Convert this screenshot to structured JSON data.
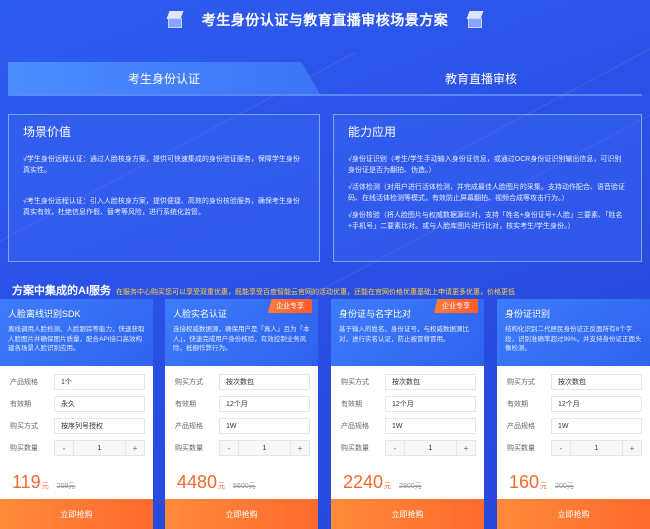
{
  "header": {
    "title": "考生身份认证与教育直播审核场景方案"
  },
  "tabs": [
    {
      "label": "考生身份认证",
      "active": true
    },
    {
      "label": "教育直播审核",
      "active": false
    }
  ],
  "left_panel": {
    "title": "场景价值",
    "paragraphs": [
      "√学生身份远程认证：通过人脸核身方案，提供可快速集成的身份验证服务，保障学生身份真实性。",
      "√考生身份远程认证：引入人脸核身方案，提供便捷、高效的身份核验服务，确保考生身份真实有效，杜绝信息作假、替考等风险，进行系统化监管。"
    ]
  },
  "right_panel": {
    "title": "能力应用",
    "paragraphs": [
      "√身份证识别（考生/学生手动输入身份证信息，或通过OCR身份证识别输出信息，可识别身份证是否为翻拍、伪造。）",
      "√活体检测（对用户进行活体检测，并完成最佳人脸图片的采集。支持动作配合、语音验证码、在线活体检测等模式，有效防止屏幕翻拍、视频合成等攻击行为。）",
      "√身份核验（将人脸图片与权威数据源比对，支持「姓名+身份证号+人脸」三要素、「姓名+手机号」二要素比对。或与人脸库图片进行比对，核实考生/学生身份。）"
    ]
  },
  "section": {
    "title": "方案中集成的AI服务",
    "subtitle": "在服务中心购买您可以享受双重优惠，既能享受百度智能云官网的活动优惠，还能在官网价格优惠基础上申请更多优惠，价格更低"
  },
  "cards": [
    {
      "name": "人脸离线识别SDK",
      "desc": "离线调用人脸检测、人脸跟踪等能力，快速获取人脸图片并确保图片质量，配合API接口高效构建各场景人脸识别应用。",
      "badge": "",
      "fields": [
        {
          "label": "产品规格",
          "value": "1个"
        },
        {
          "label": "有效期",
          "value": "永久"
        },
        {
          "label": "购买方式",
          "value": "按序列号授权"
        }
      ],
      "qty_label": "购买数量",
      "qty": "1",
      "price": "119",
      "unit": "元",
      "old_price": "209元",
      "buy_label": "立即抢购"
    },
    {
      "name": "人脸实名认证",
      "desc": "连接权威数据源，确保用户是「真人」且为「本人」，快速完成用户身份核验，有效控制业务风险，抵御作弊行为。",
      "badge": "企业专享",
      "fields": [
        {
          "label": "购买方式",
          "value": "按次数包"
        },
        {
          "label": "有效期",
          "value": "12个月"
        },
        {
          "label": "产品规格",
          "value": "1W"
        }
      ],
      "qty_label": "购买数量",
      "qty": "1",
      "price": "4480",
      "unit": "元",
      "old_price": "5600元",
      "buy_label": "立即抢购"
    },
    {
      "name": "身份证与名字比对",
      "desc": "基于输入的姓名、身份证号，与权威数据源比对，进行实名认证，防止被冒替冒用。",
      "badge": "企业专享",
      "fields": [
        {
          "label": "购买方式",
          "value": "按次数包"
        },
        {
          "label": "有效期",
          "value": "12个月"
        },
        {
          "label": "产品规格",
          "value": "1W"
        }
      ],
      "qty_label": "购买数量",
      "qty": "1",
      "price": "2240",
      "unit": "元",
      "old_price": "2800元",
      "buy_label": "立即抢购"
    },
    {
      "name": "身份证识别",
      "desc": "结构化识别二代居民身份证正反面所有8个字段，识别准确率超过99%，并支持身份证正面头像检测。",
      "badge": "",
      "fields": [
        {
          "label": "购买方式",
          "value": "按次数包"
        },
        {
          "label": "有效期",
          "value": "12个月"
        },
        {
          "label": "产品规格",
          "value": "1W"
        }
      ],
      "qty_label": "购买数量",
      "qty": "1",
      "price": "160",
      "unit": "元",
      "old_price": "200元",
      "buy_label": "立即抢购"
    }
  ]
}
